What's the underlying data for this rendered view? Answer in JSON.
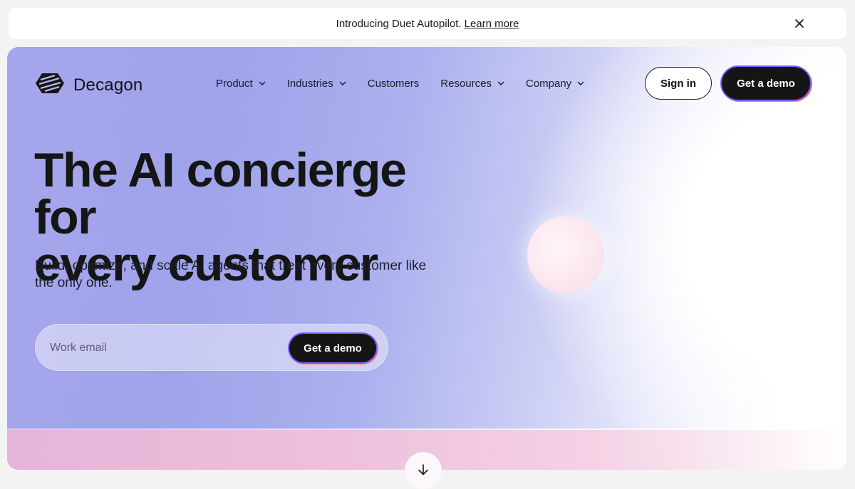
{
  "announcement": {
    "text": "Introducing Duet Autopilot.",
    "link": "Learn more",
    "close_icon": "close-icon"
  },
  "header": {
    "brand": "Decagon",
    "nav": [
      {
        "label": "Product",
        "has_dropdown": true
      },
      {
        "label": "Industries",
        "has_dropdown": true
      },
      {
        "label": "Customers",
        "has_dropdown": false
      },
      {
        "label": "Resources",
        "has_dropdown": true
      },
      {
        "label": "Company",
        "has_dropdown": true
      }
    ],
    "signin_label": "Sign in",
    "demo_label": "Get a demo"
  },
  "hero": {
    "title_line1": "The AI concierge for",
    "title_line2": "every customer",
    "subtitle": "Build, optimize, and scale AI agents that treat every customer like the only one.",
    "email_placeholder": "Work email",
    "form_button": "Get a demo"
  },
  "colors": {
    "accent_dark": "#151515",
    "gradient_start": "#a7a6ec",
    "border_purple": "#7c5cff",
    "border_orange": "#ff7a59"
  },
  "icons": [
    "decagon-logo-icon",
    "chevron-down-icon",
    "close-icon",
    "arrow-down-icon"
  ]
}
